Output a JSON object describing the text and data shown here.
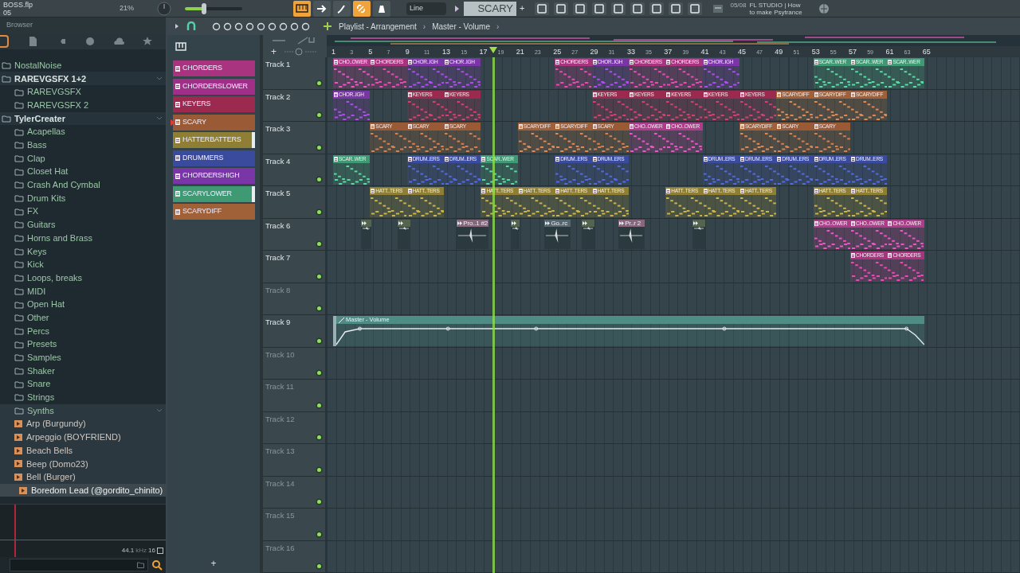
{
  "toolbar": {
    "file_name": "BOSS.flp",
    "file_sub": "05",
    "cpu": "21%",
    "master_volume": {
      "level": 0.33
    },
    "snap": "Line",
    "pattern": "SCARY",
    "add_pattern": "+",
    "hint_time": "05/08",
    "hint_lines": [
      "FL STUDIO | How",
      "to make Psytrance"
    ]
  },
  "browser": {
    "title": "Browser",
    "tree": [
      {
        "label": "NostalNoise",
        "kind": "folder",
        "expanded": false
      },
      {
        "label": "RAREVGSFX 1+2",
        "kind": "root",
        "expanded": true,
        "children": [
          {
            "label": "RAREVGSFX",
            "kind": "folder",
            "expanded": false
          },
          {
            "label": "RAREVGSFX 2",
            "kind": "folder",
            "expanded": false
          }
        ]
      },
      {
        "label": "TylerCreater",
        "kind": "root",
        "expanded": true,
        "children": [
          {
            "label": "Acapellas",
            "kind": "folder",
            "expanded": false
          },
          {
            "label": "Bass",
            "kind": "folder",
            "expanded": false
          },
          {
            "label": "Clap",
            "kind": "folder",
            "expanded": false
          },
          {
            "label": "Closet Hat",
            "kind": "folder",
            "expanded": false
          },
          {
            "label": "Crash And Cymbal",
            "kind": "folder",
            "expanded": false
          },
          {
            "label": "Drum Kits",
            "kind": "folder",
            "expanded": false
          },
          {
            "label": "FX",
            "kind": "folder",
            "expanded": false
          },
          {
            "label": "Guitars",
            "kind": "folder",
            "expanded": false
          },
          {
            "label": "Horns and Brass",
            "kind": "folder",
            "expanded": false
          },
          {
            "label": "Keys",
            "kind": "folder",
            "expanded": false
          },
          {
            "label": "Kick",
            "kind": "folder",
            "expanded": false
          },
          {
            "label": "Loops, breaks",
            "kind": "folder",
            "expanded": false
          },
          {
            "label": "MIDI",
            "kind": "folder",
            "expanded": false
          },
          {
            "label": "Open Hat",
            "kind": "folder",
            "expanded": false
          },
          {
            "label": "Other",
            "kind": "folder",
            "expanded": false
          },
          {
            "label": "Percs",
            "kind": "folder",
            "expanded": false
          },
          {
            "label": "Presets",
            "kind": "folder",
            "expanded": false
          },
          {
            "label": "Samples",
            "kind": "folder",
            "expanded": false
          },
          {
            "label": "Shaker",
            "kind": "folder",
            "expanded": false
          },
          {
            "label": "Snare",
            "kind": "folder",
            "expanded": false
          },
          {
            "label": "Strings",
            "kind": "folder",
            "expanded": false
          },
          {
            "label": "Synths",
            "kind": "folder",
            "expanded": true,
            "children": [
              {
                "label": "Arp (Burgundy)",
                "kind": "preset",
                "selected": false
              },
              {
                "label": "Arpeggio (BOYFRIEND)",
                "kind": "preset",
                "selected": false
              },
              {
                "label": "Beach Bells",
                "kind": "preset",
                "selected": false
              },
              {
                "label": "Beep (Domo23)",
                "kind": "preset",
                "selected": false
              },
              {
                "label": "Bell (Burger)",
                "kind": "preset",
                "selected": false
              },
              {
                "label": "Boredom Lead (@gordito_chinito)",
                "kind": "preset",
                "selected": true
              }
            ]
          }
        ]
      }
    ],
    "sample_rate": "44.1",
    "rate_unit": "kHz",
    "bit_depth": "16"
  },
  "playlist": {
    "title": "Playlist - Arrangement",
    "breadcrumb": "Master - Volume",
    "separators": [
      "›",
      "›"
    ],
    "add_pattern": "+",
    "add_track": "+",
    "ruler": [
      "1",
      "3",
      "5",
      "7",
      "9",
      "11",
      "13",
      "15",
      "17",
      "19",
      "21",
      "23",
      "25",
      "27",
      "29",
      "31",
      "33",
      "35",
      "37",
      "39",
      "41",
      "43",
      "45",
      "47",
      "49",
      "51",
      "53",
      "55",
      "57",
      "59",
      "61",
      "63",
      "65"
    ],
    "patterns": [
      {
        "label": "CHORDERS",
        "color": "#a8337f",
        "selected": false,
        "marked": false
      },
      {
        "label": "CHORDERSLOWER",
        "color": "#a02f88",
        "selected": false,
        "marked": false
      },
      {
        "label": "KEYERS",
        "color": "#9b2a4e",
        "selected": false,
        "marked": false
      },
      {
        "label": "SCARY",
        "color": "#9a5a35",
        "selected": true,
        "marked": false
      },
      {
        "label": "HATTERBATTERS",
        "color": "#8f7f35",
        "selected": false,
        "marked": true
      },
      {
        "label": "DRUMMERS",
        "color": "#3a4a9c",
        "selected": false,
        "marked": false
      },
      {
        "label": "CHORDERSHIGH",
        "color": "#7a36a6",
        "selected": false,
        "marked": false
      },
      {
        "label": "SCARYLOWER",
        "color": "#3f9a74",
        "selected": false,
        "marked": true
      },
      {
        "label": "SCARYDIFF",
        "color": "#a06038",
        "selected": false,
        "marked": false
      }
    ],
    "tracks": [
      {
        "name": "Track 1",
        "dimmed": false,
        "clips": [
          {
            "kind": "pattern",
            "label": "CHO..OWER",
            "color": "#b03a8c"
          },
          {
            "kind": "pattern",
            "label": "CHORDERS",
            "color": "#a8337f"
          },
          {
            "kind": "pattern",
            "label": "CHOR..IGH",
            "color": "#7a36a6"
          },
          {
            "kind": "pattern",
            "label": "CHOR..IGH",
            "color": "#7a36a6"
          },
          {
            "kind": "pattern",
            "label": "CHORDERS",
            "color": "#a8337f"
          },
          {
            "kind": "pattern",
            "label": "CHOR..IGH",
            "color": "#7a36a6"
          },
          {
            "kind": "pattern",
            "label": "CHORDERS",
            "color": "#a8337f"
          },
          {
            "kind": "pattern",
            "label": "CHORDERS",
            "color": "#a8337f"
          },
          {
            "kind": "pattern",
            "label": "CHOR..IGH",
            "color": "#7a36a6"
          },
          {
            "kind": "pattern",
            "label": "SCAR..WER",
            "color": "#3f9a74"
          },
          {
            "kind": "pattern",
            "label": "SCAR..WER",
            "color": "#3f9a74"
          },
          {
            "kind": "pattern",
            "label": "SCAR..WER",
            "color": "#3f9a74"
          }
        ]
      },
      {
        "name": "Track 2",
        "dimmed": false,
        "clips": [
          {
            "kind": "pattern",
            "label": "CHOR..IGH",
            "color": "#7a36a6"
          },
          {
            "kind": "pattern",
            "label": "KEYERS",
            "color": "#9b2a4e"
          },
          {
            "kind": "pattern",
            "label": "KEYERS",
            "color": "#9b2a4e"
          },
          {
            "kind": "pattern",
            "label": "KEYERS",
            "color": "#9b2a4e"
          },
          {
            "kind": "pattern",
            "label": "KEYERS",
            "color": "#9b2a4e"
          },
          {
            "kind": "pattern",
            "label": "KEYERS",
            "color": "#9b2a4e"
          },
          {
            "kind": "pattern",
            "label": "KEYERS",
            "color": "#9b2a4e"
          },
          {
            "kind": "pattern",
            "label": "KEYERS",
            "color": "#9b2a4e"
          },
          {
            "kind": "pattern",
            "label": "SCARYDIFF",
            "color": "#a06038"
          },
          {
            "kind": "pattern",
            "label": "SCARYDIFF",
            "color": "#a06038"
          },
          {
            "kind": "pattern",
            "label": "SCARYDIFF",
            "color": "#a06038"
          }
        ]
      },
      {
        "name": "Track 3",
        "dimmed": false,
        "clips": [
          {
            "kind": "pattern",
            "label": "SCARY",
            "color": "#9a5a35"
          },
          {
            "kind": "pattern",
            "label": "SCARY",
            "color": "#9a5a35"
          },
          {
            "kind": "pattern",
            "label": "SCARY",
            "color": "#9a5a35"
          },
          {
            "kind": "pattern",
            "label": "SCARYDIFF",
            "color": "#a06038"
          },
          {
            "kind": "pattern",
            "label": "SCARYDIFF",
            "color": "#a06038"
          },
          {
            "kind": "pattern",
            "label": "SCARY",
            "color": "#9a5a35"
          },
          {
            "kind": "pattern",
            "label": "CHO..OWER",
            "color": "#b03a8c"
          },
          {
            "kind": "pattern",
            "label": "CHO..OWER",
            "color": "#b03a8c"
          },
          {
            "kind": "pattern",
            "label": "SCARYDIFF",
            "color": "#a06038"
          },
          {
            "kind": "pattern",
            "label": "SCARY",
            "color": "#9a5a35"
          },
          {
            "kind": "pattern",
            "label": "SCARY",
            "color": "#9a5a35"
          }
        ]
      },
      {
        "name": "Track 4",
        "dimmed": false,
        "clips": [
          {
            "kind": "pattern",
            "label": "SCAR..WER",
            "color": "#3f9a74"
          },
          {
            "kind": "pattern",
            "label": "DRUM..ERS",
            "color": "#3a4a9c"
          },
          {
            "kind": "pattern",
            "label": "DRUM..ERS",
            "color": "#3a4a9c"
          },
          {
            "kind": "pattern",
            "label": "SCAR..WER",
            "color": "#3f9a74"
          },
          {
            "kind": "pattern",
            "label": "DRUM..ERS",
            "color": "#3a4a9c"
          },
          {
            "kind": "pattern",
            "label": "DRUM..ERS",
            "color": "#3a4a9c"
          },
          {
            "kind": "pattern",
            "label": "DRUM..ERS",
            "color": "#3a4a9c"
          },
          {
            "kind": "pattern",
            "label": "DRUM..ERS",
            "color": "#3a4a9c"
          },
          {
            "kind": "pattern",
            "label": "DRUM..ERS",
            "color": "#3a4a9c"
          },
          {
            "kind": "pattern",
            "label": "DRUM..ERS",
            "color": "#3a4a9c"
          },
          {
            "kind": "pattern",
            "label": "DRUM..ERS",
            "color": "#3a4a9c"
          }
        ]
      },
      {
        "name": "Track 5",
        "dimmed": false,
        "clips": [
          {
            "kind": "pattern",
            "label": "HATT..TERS",
            "color": "#8f7f35"
          },
          {
            "kind": "pattern",
            "label": "HATT..TERS",
            "color": "#8f7f35"
          },
          {
            "kind": "pattern",
            "label": "HATT..TERS",
            "color": "#8f7f35"
          },
          {
            "kind": "pattern",
            "label": "HATT..TERS",
            "color": "#8f7f35"
          },
          {
            "kind": "pattern",
            "label": "HATT..TERS",
            "color": "#8f7f35"
          },
          {
            "kind": "pattern",
            "label": "HATT..TERS",
            "color": "#8f7f35"
          },
          {
            "kind": "pattern",
            "label": "HATT..TERS",
            "color": "#8f7f35"
          },
          {
            "kind": "pattern",
            "label": "HATT..TERS",
            "color": "#8f7f35"
          },
          {
            "kind": "pattern",
            "label": "HATT..TERS",
            "color": "#8f7f35"
          },
          {
            "kind": "pattern",
            "label": "HATT..TERS",
            "color": "#8f7f35"
          },
          {
            "kind": "pattern",
            "label": "HATT..TERS",
            "color": "#8f7f35"
          }
        ]
      },
      {
        "name": "Track 6",
        "dimmed": false,
        "clips": [
          {
            "kind": "audio",
            "color": "#55644f"
          },
          {
            "kind": "audio",
            "color": "#55644f"
          },
          {
            "kind": "audio",
            "label": "Pro..1 #2",
            "color": "#86687a"
          },
          {
            "kind": "audio",
            "color": "#55644f"
          },
          {
            "kind": "audio",
            "label": "Go..rc",
            "color": "#56676e"
          },
          {
            "kind": "audio",
            "color": "#55644f"
          },
          {
            "kind": "audio",
            "label": "Pr..r 2",
            "color": "#86687a"
          },
          {
            "kind": "audio",
            "color": "#55644f"
          },
          {
            "kind": "pattern",
            "label": "CHO..OWER",
            "color": "#b03a8c"
          },
          {
            "kind": "pattern",
            "label": "CHO..OWER",
            "color": "#b03a8c"
          },
          {
            "kind": "pattern",
            "label": "CHO..OWER",
            "color": "#b03a8c"
          }
        ]
      },
      {
        "name": "Track 7",
        "dimmed": false,
        "clips": [
          {
            "kind": "pattern",
            "label": "CHORDERS",
            "color": "#a8337f"
          },
          {
            "kind": "pattern",
            "label": "CHORDERS",
            "color": "#a8337f"
          }
        ]
      },
      {
        "name": "Track 8",
        "dimmed": true
      },
      {
        "name": "Track 9",
        "dimmed": false,
        "clips": [
          {
            "kind": "automation",
            "label": "Master - Volume",
            "color": "#4f8c86"
          }
        ]
      },
      {
        "name": "Track 10",
        "dimmed": true
      },
      {
        "name": "Track 11",
        "dimmed": true
      },
      {
        "name": "Track 12",
        "dimmed": true
      },
      {
        "name": "Track 13",
        "dimmed": true
      },
      {
        "name": "Track 14",
        "dimmed": true
      },
      {
        "name": "Track 15",
        "dimmed": true
      },
      {
        "name": "Track 16",
        "dimmed": true
      }
    ]
  }
}
